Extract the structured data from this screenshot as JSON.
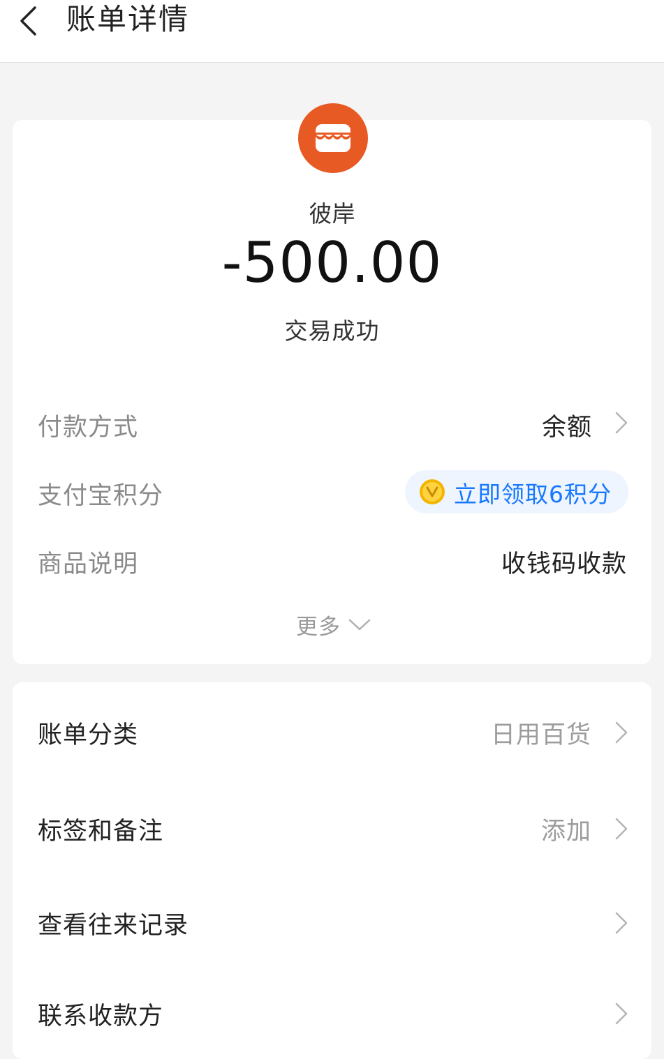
{
  "header": {
    "title": "账单详情"
  },
  "transaction": {
    "merchant": "彼岸",
    "amount": "-500.00",
    "status": "交易成功"
  },
  "details": {
    "payment_method": {
      "label": "付款方式",
      "value": "余额"
    },
    "points": {
      "label": "支付宝积分",
      "value": "立即领取6积分"
    },
    "description": {
      "label": "商品说明",
      "value": "收钱码收款"
    },
    "more_label": "更多"
  },
  "actions": {
    "category": {
      "label": "账单分类",
      "value": "日用百货"
    },
    "tags": {
      "label": "标签和备注",
      "value": "添加"
    },
    "history": {
      "label": "查看往来记录"
    },
    "contact": {
      "label": "联系收款方"
    }
  },
  "colors": {
    "accent": "#1677ff",
    "merchant_logo": "#e85a24",
    "coin": "#f4b400",
    "background": "#f4f4f4"
  },
  "icons": {
    "back": "chevron-left-icon",
    "merchant": "shop-icon",
    "coin": "coin-icon",
    "row_arrow": "chevron-right-icon",
    "more": "chevron-down-icon"
  }
}
